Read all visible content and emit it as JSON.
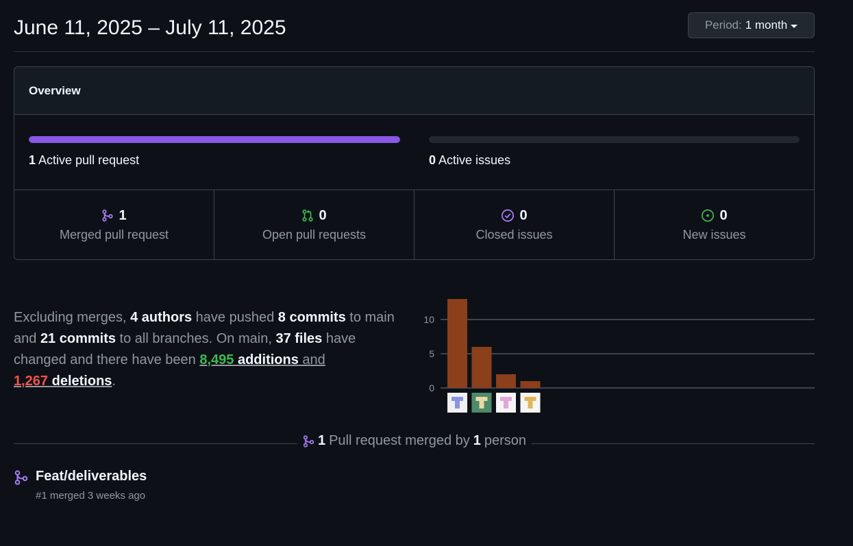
{
  "header": {
    "date_range": "June 11, 2025 – July 11, 2025",
    "period_label": "Period:",
    "period_value": "1 month"
  },
  "overview": {
    "title": "Overview",
    "active_prs": {
      "count": "1",
      "label": "Active pull request",
      "fill_fraction": 1.0,
      "color": "#8957e5"
    },
    "active_issues": {
      "count": "0",
      "label": "Active issues",
      "fill_fraction": 0.0
    },
    "stats": [
      {
        "icon": "merged-pr-icon",
        "count": "1",
        "label": "Merged pull request",
        "color": "#ab7df8"
      },
      {
        "icon": "open-pr-icon",
        "count": "0",
        "label": "Open pull requests",
        "color": "#3fb950"
      },
      {
        "icon": "closed-issue-icon",
        "count": "0",
        "label": "Closed issues",
        "color": "#ab7df8"
      },
      {
        "icon": "new-issue-icon",
        "count": "0",
        "label": "New issues",
        "color": "#3fb950"
      }
    ]
  },
  "summary": {
    "p1": "Excluding merges, ",
    "authors": "4 authors",
    "p2": " have pushed ",
    "commits_main": "8 commits",
    "p3": " to main and ",
    "commits_all": "21 commits",
    "p4": " to all branches. On main, ",
    "files": "37 files",
    "p5": " have changed and there have been ",
    "additions_num": "8,495",
    "additions_word": "additions",
    "p6": " and",
    "deletions_num": "1,267",
    "deletions_word": "deletions",
    "p7": "."
  },
  "chart_data": {
    "type": "bar",
    "categories": [
      "author-1",
      "author-2",
      "author-3",
      "author-4"
    ],
    "values": [
      13,
      6,
      2,
      1
    ],
    "yticks": [
      0,
      5,
      10
    ],
    "ylim": [
      0,
      13
    ],
    "bar_color": "#8b3f1b",
    "grid": true
  },
  "merged_section": {
    "count": "1",
    "text_mid": "Pull request merged by",
    "people": "1",
    "text_end": "person"
  },
  "pr_list": [
    {
      "title": "Feat/deliverables",
      "meta": "#1 merged 3 weeks ago"
    }
  ]
}
